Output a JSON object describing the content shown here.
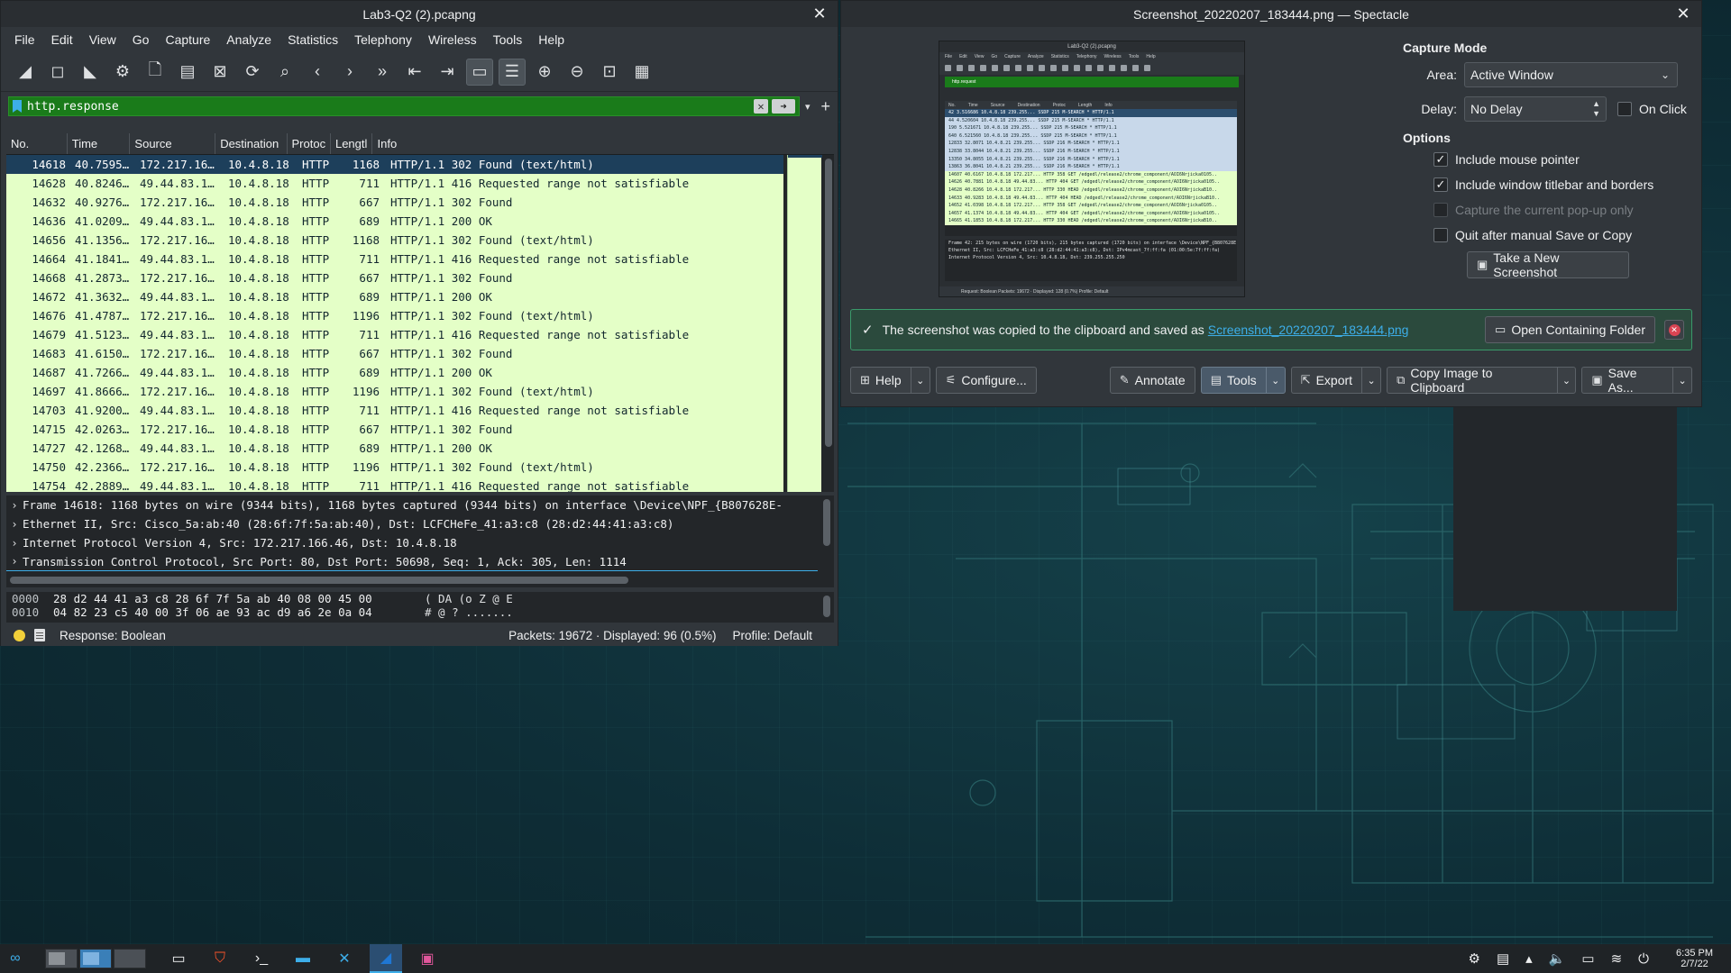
{
  "wireshark": {
    "title": "Lab3-Q2 (2).pcapng",
    "menu": [
      "File",
      "Edit",
      "View",
      "Go",
      "Capture",
      "Analyze",
      "Statistics",
      "Telephony",
      "Wireless",
      "Tools",
      "Help"
    ],
    "filter_value": "http.response",
    "columns": [
      "No.",
      "Time",
      "Source",
      "Destination",
      "Protoc",
      "Lengtl",
      "Info"
    ],
    "packets": [
      {
        "no": "14618",
        "time": "40.7595…",
        "src": "172.217.16…",
        "dst": "10.4.8.18",
        "proto": "HTTP",
        "len": "1168",
        "info": "HTTP/1.1 302 Found  (text/html)"
      },
      {
        "no": "14628",
        "time": "40.8246…",
        "src": "49.44.83.1…",
        "dst": "10.4.8.18",
        "proto": "HTTP",
        "len": "711",
        "info": "HTTP/1.1 416 Requested range not satisfiable"
      },
      {
        "no": "14632",
        "time": "40.9276…",
        "src": "172.217.16…",
        "dst": "10.4.8.18",
        "proto": "HTTP",
        "len": "667",
        "info": "HTTP/1.1 302 Found"
      },
      {
        "no": "14636",
        "time": "41.0209…",
        "src": "49.44.83.1…",
        "dst": "10.4.8.18",
        "proto": "HTTP",
        "len": "689",
        "info": "HTTP/1.1 200 OK"
      },
      {
        "no": "14656",
        "time": "41.1356…",
        "src": "172.217.16…",
        "dst": "10.4.8.18",
        "proto": "HTTP",
        "len": "1168",
        "info": "HTTP/1.1 302 Found  (text/html)"
      },
      {
        "no": "14664",
        "time": "41.1841…",
        "src": "49.44.83.1…",
        "dst": "10.4.8.18",
        "proto": "HTTP",
        "len": "711",
        "info": "HTTP/1.1 416 Requested range not satisfiable"
      },
      {
        "no": "14668",
        "time": "41.2873…",
        "src": "172.217.16…",
        "dst": "10.4.8.18",
        "proto": "HTTP",
        "len": "667",
        "info": "HTTP/1.1 302 Found"
      },
      {
        "no": "14672",
        "time": "41.3632…",
        "src": "49.44.83.1…",
        "dst": "10.4.8.18",
        "proto": "HTTP",
        "len": "689",
        "info": "HTTP/1.1 200 OK"
      },
      {
        "no": "14676",
        "time": "41.4787…",
        "src": "172.217.16…",
        "dst": "10.4.8.18",
        "proto": "HTTP",
        "len": "1196",
        "info": "HTTP/1.1 302 Found  (text/html)"
      },
      {
        "no": "14679",
        "time": "41.5123…",
        "src": "49.44.83.1…",
        "dst": "10.4.8.18",
        "proto": "HTTP",
        "len": "711",
        "info": "HTTP/1.1 416 Requested range not satisfiable"
      },
      {
        "no": "14683",
        "time": "41.6150…",
        "src": "172.217.16…",
        "dst": "10.4.8.18",
        "proto": "HTTP",
        "len": "667",
        "info": "HTTP/1.1 302 Found"
      },
      {
        "no": "14687",
        "time": "41.7266…",
        "src": "49.44.83.1…",
        "dst": "10.4.8.18",
        "proto": "HTTP",
        "len": "689",
        "info": "HTTP/1.1 200 OK"
      },
      {
        "no": "14697",
        "time": "41.8666…",
        "src": "172.217.16…",
        "dst": "10.4.8.18",
        "proto": "HTTP",
        "len": "1196",
        "info": "HTTP/1.1 302 Found  (text/html)"
      },
      {
        "no": "14703",
        "time": "41.9200…",
        "src": "49.44.83.1…",
        "dst": "10.4.8.18",
        "proto": "HTTP",
        "len": "711",
        "info": "HTTP/1.1 416 Requested range not satisfiable"
      },
      {
        "no": "14715",
        "time": "42.0263…",
        "src": "172.217.16…",
        "dst": "10.4.8.18",
        "proto": "HTTP",
        "len": "667",
        "info": "HTTP/1.1 302 Found"
      },
      {
        "no": "14727",
        "time": "42.1268…",
        "src": "49.44.83.1…",
        "dst": "10.4.8.18",
        "proto": "HTTP",
        "len": "689",
        "info": "HTTP/1.1 200 OK"
      },
      {
        "no": "14750",
        "time": "42.2366…",
        "src": "172.217.16…",
        "dst": "10.4.8.18",
        "proto": "HTTP",
        "len": "1196",
        "info": "HTTP/1.1 302 Found  (text/html)"
      },
      {
        "no": "14754",
        "time": "42.2889…",
        "src": "49.44.83.1…",
        "dst": "10.4.8.18",
        "proto": "HTTP",
        "len": "711",
        "info": "HTTP/1.1 416 Requested range not satisfiable"
      }
    ],
    "details": [
      "Frame 14618: 1168 bytes on wire (9344 bits), 1168 bytes captured (9344 bits) on interface \\Device\\NPF_{B807628E-",
      "Ethernet II, Src: Cisco_5a:ab:40 (28:6f:7f:5a:ab:40), Dst: LCFCHeFe_41:a3:c8 (28:d2:44:41:a3:c8)",
      "Internet Protocol Version 4, Src: 172.217.166.46, Dst: 10.4.8.18",
      "Transmission Control Protocol, Src Port: 80, Dst Port: 50698, Seq: 1, Ack: 305, Len: 1114"
    ],
    "bytes": [
      {
        "offset": "0000",
        "hex": "28 d2 44 41 a3 c8 28 6f  7f 5a ab 40 08 00 45 00",
        "ascii": "( DA  (o  Z @  E"
      },
      {
        "offset": "0010",
        "hex": "04 82 23 c5 40 00 3f 06  ae 93 ac d9 a6 2e 0a 04",
        "ascii": "  # @ ?  ......."
      }
    ],
    "status": {
      "field": "Response: Boolean",
      "packets": "Packets: 19672 · Displayed: 96 (0.5%)",
      "profile": "Profile: Default"
    }
  },
  "spectacle": {
    "title": "Screenshot_20220207_183444.png — Spectacle",
    "preview": {
      "title": "Lab3-Q2 (2).pcapng",
      "menu": [
        "File",
        "Edit",
        "View",
        "Go",
        "Capture",
        "Analyze",
        "Statistics",
        "Telephony",
        "Wireless",
        "Tools",
        "Help"
      ],
      "filter": "http.request",
      "header": [
        "No.",
        "Time",
        "Source",
        "Destination",
        "Protoc",
        "Length",
        "Info"
      ],
      "rows": [
        {
          "kind": "s",
          "text": "42 3.516686  10.4.8.18   239.255...  SSDP  215 M-SEARCH * HTTP/1.1"
        },
        {
          "kind": "b",
          "text": "44 4.520604  10.4.8.18   239.255...  SSDP  215 M-SEARCH * HTTP/1.1"
        },
        {
          "kind": "b",
          "text": "190 5.521671  10.4.8.18   239.255...  SSDP  215 M-SEARCH * HTTP/1.1"
        },
        {
          "kind": "b",
          "text": "640 6.521560  10.4.8.18   239.255...  SSDP  215 M-SEARCH * HTTP/1.1"
        },
        {
          "kind": "b",
          "text": "12833 32.8071  10.4.8.21   239.255...  SSDP  216 M-SEARCH * HTTP/1.1"
        },
        {
          "kind": "b",
          "text": "12838 33.8044  10.4.8.21   239.255...  SSDP  216 M-SEARCH * HTTP/1.1"
        },
        {
          "kind": "b",
          "text": "13350 34.8055  10.4.8.21   239.255...  SSDP  216 M-SEARCH * HTTP/1.1"
        },
        {
          "kind": "b",
          "text": "13863 36.8041  10.4.8.21   239.255...  SSDP  216 M-SEARCH * HTTP/1.1"
        },
        {
          "kind": "g",
          "text": "14607 40.6167  10.4.8.18   172.217...  HTTP  358 GET /edgedl/release2/chrome_component/AOI6Nrjicka0105.."
        },
        {
          "kind": "g",
          "text": "14626 40.7881  10.4.8.18   49.44.83...  HTTP  404 GET /edgedl/release2/chrome_component/AOI6Nrjicka0105.."
        },
        {
          "kind": "g",
          "text": "14628 40.8266  10.4.8.18   172.217...  HTTP  330 HEAD /edgedl/release2/chrome_component/AOI6NrjickaB10.."
        },
        {
          "kind": "g",
          "text": "14633 40.9283  10.4.8.18   49.44.83...  HTTP  404 HEAD /edgedl/release2/chrome_component/AOI6NrjickaB10.."
        },
        {
          "kind": "g",
          "text": "14652 41.0398  10.4.8.18   172.217...  HTTP  358 GET /edgedl/release2/chrome_component/AOI6Nrjicka0105.."
        },
        {
          "kind": "g",
          "text": "14657 41.1374  10.4.8.18   49.44.83...  HTTP  404 GET /edgedl/release2/chrome_component/AOI6Nrjicka0105.."
        },
        {
          "kind": "g",
          "text": "14665 41.1853  10.4.8.18   172.217...  HTTP  330 HEAD /edgedl/release2/chrome_component/AOI6NrjickaB10.."
        }
      ],
      "details": [
        "Frame 42: 215 bytes on wire (1720 bits), 215 bytes captured (1720 bits) on interface \\Device\\NPF_{B807628E-022D-",
        "Ethernet II, Src: LCFCHeFe_41:a3:c8 (28:d2:44:41:a3:c8), Dst: IPv4mcast_7f:ff:fa (01:00:5e:7f:ff:fa)",
        "Internet Protocol Version 4, Src: 10.4.8.18, Dst: 239.255.255.250"
      ],
      "status": "Request: Boolean                                                    Packets: 19672 · Displayed: 128 (0.7%)   Profile: Default"
    },
    "options": {
      "capture_mode_heading": "Capture Mode",
      "area_label": "Area:",
      "area_value": "Active Window",
      "delay_label": "Delay:",
      "delay_value": "No Delay",
      "on_click_label": "On Click",
      "options_heading": "Options",
      "opt_mouse": "Include mouse pointer",
      "opt_titlebar": "Include window titlebar and borders",
      "opt_popup": "Capture the current pop-up only",
      "opt_quit": "Quit after manual Save or Copy",
      "take_new": "Take a New Screenshot"
    },
    "banner": {
      "message": "The screenshot was copied to the clipboard and saved as",
      "link": "Screenshot_20220207_183444.png",
      "open_folder": "Open Containing Folder"
    },
    "bottom": {
      "help": "Help",
      "configure": "Configure...",
      "annotate": "Annotate",
      "tools": "Tools",
      "export": "Export",
      "copy_clipboard": "Copy Image to Clipboard",
      "save_as": "Save As..."
    }
  },
  "taskbar": {
    "time": "6:35 PM",
    "date": "2/7/22"
  },
  "colors": {
    "selection": "#1d3f5b",
    "http_row_bg": "#e4ffc7",
    "filter_bg": "#1a7b1a",
    "accent": "#3daee9"
  }
}
